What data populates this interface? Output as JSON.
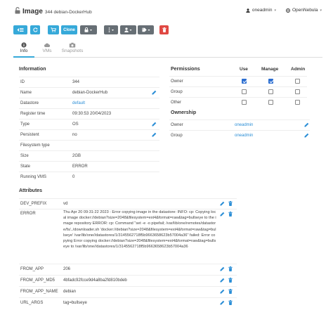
{
  "header": {
    "title": "Image",
    "subtitle": "344 debian-DockerHub",
    "user": "oneadmin",
    "zone": "OpenNebula"
  },
  "toolbar": {
    "clone_label": "Clone"
  },
  "tabs": [
    {
      "label": "Info",
      "icon": "info-icon"
    },
    {
      "label": "VMs",
      "icon": "cloud-icon"
    },
    {
      "label": "Snapshots",
      "icon": "camera-icon"
    }
  ],
  "information": {
    "title": "Information",
    "rows": [
      {
        "key": "ID",
        "value": "344"
      },
      {
        "key": "Name",
        "value": "debian-DockerHub"
      },
      {
        "key": "Datastore",
        "value": "default"
      },
      {
        "key": "Register time",
        "value": "09:30:53 20/04/2023"
      },
      {
        "key": "Type",
        "value": "OS"
      },
      {
        "key": "Persistent",
        "value": "no"
      },
      {
        "key": "Filesystem type",
        "value": ""
      },
      {
        "key": "Size",
        "value": "2GB"
      },
      {
        "key": "State",
        "value": "ERROR"
      },
      {
        "key": "Running VMS",
        "value": "0"
      }
    ]
  },
  "permissions": {
    "title": "Permissions",
    "columns": [
      "Use",
      "Manage",
      "Admin"
    ],
    "rows": [
      {
        "label": "Owner",
        "use": true,
        "manage": true,
        "admin": false
      },
      {
        "label": "Group",
        "use": false,
        "manage": false,
        "admin": false
      },
      {
        "label": "Other",
        "use": false,
        "manage": false,
        "admin": false
      }
    ]
  },
  "ownership": {
    "title": "Ownership",
    "rows": [
      {
        "key": "Owner",
        "value": "oneadmin"
      },
      {
        "key": "Group",
        "value": "oneadmin"
      }
    ]
  },
  "attributes": {
    "title": "Attributes",
    "rows": [
      {
        "key": "DEV_PREFIX",
        "value": "vd"
      },
      {
        "key": "ERROR",
        "value": "Thu Apr 20 09:31:22 2023 : Error copying image in the datastore: INFO: cp: Copying local image docker://debian?size=2048&filesystem=ext4&format=raw&tag=bullseye to the image repository ERROR: cp: Command \"set -e -o pipefail; /var/lib/one/remotes/datastore/fs/../downloader.sh 'docker://debian?size=2048&filesystem=ext4&format=raw&tag=bullseye' /var/lib/one//datastores/1/3145562718f5b9663658623b57004a36\" failed: Error copying Error copying docker://debian?size=2048&filesystem=ext4&format=raw&tag=bullseye to /var/lib/one//datastores/1/3145562718f5b9663658623b57004a36"
      },
      {
        "key": "FROM_APP",
        "value": "206"
      },
      {
        "key": "FROM_APP_MD5",
        "value": "4bfadc92fcce9d4a8ba2fd810bdeb"
      },
      {
        "key": "FROM_APP_NAME",
        "value": "debian"
      },
      {
        "key": "URL_ARGS",
        "value": "tag=bullseye"
      }
    ]
  }
}
